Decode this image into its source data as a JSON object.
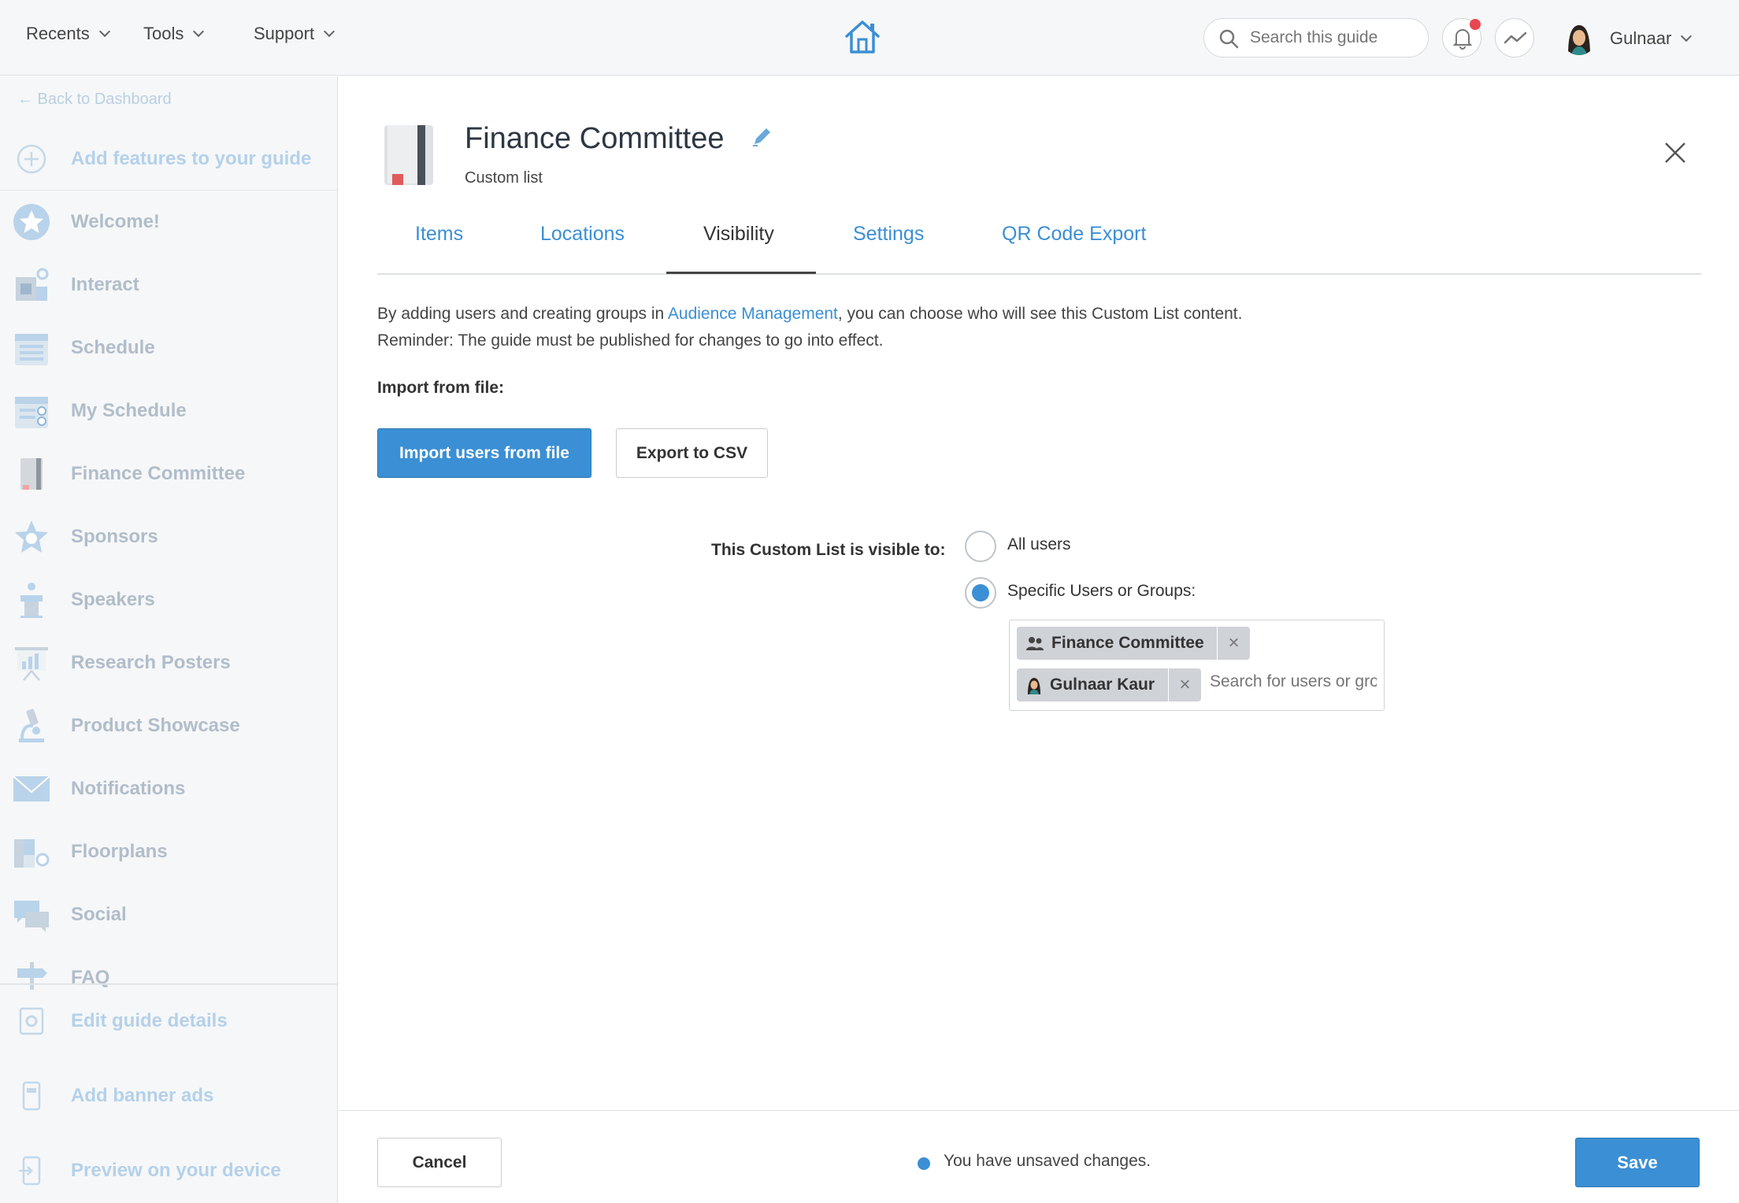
{
  "topbar": {
    "recents_label": "Recents",
    "tools_label": "Tools",
    "support_label": "Support",
    "search_placeholder": "Search this guide",
    "user_name": "Gulnaar"
  },
  "sidebar": {
    "back_label": "← Back to Dashboard",
    "add_features_label": "Add features to your guide",
    "items": [
      {
        "label": "Welcome!",
        "icon": "star-icon"
      },
      {
        "label": "Interact",
        "icon": "interact-icon"
      },
      {
        "label": "Schedule",
        "icon": "calendar-icon"
      },
      {
        "label": "My Schedule",
        "icon": "calendar-check-icon"
      },
      {
        "label": "Finance Committee",
        "icon": "book-icon"
      },
      {
        "label": "Sponsors",
        "icon": "sponsor-star-icon"
      },
      {
        "label": "Speakers",
        "icon": "podium-icon"
      },
      {
        "label": "Research Posters",
        "icon": "poster-icon"
      },
      {
        "label": "Product Showcase",
        "icon": "microscope-icon"
      },
      {
        "label": "Notifications",
        "icon": "envelope-icon"
      },
      {
        "label": "Floorplans",
        "icon": "floorplan-icon"
      },
      {
        "label": "Social",
        "icon": "chat-icon"
      },
      {
        "label": "FAQ",
        "icon": "signpost-icon"
      }
    ],
    "bottom": {
      "edit_label": "Edit guide details",
      "banner_label": "Add banner ads",
      "preview_label": "Preview on your device"
    }
  },
  "header": {
    "title": "Finance Committee",
    "subtitle": "Custom list"
  },
  "tabs": {
    "items": "Items",
    "locations": "Locations",
    "visibility": "Visibility",
    "settings": "Settings",
    "qr": "QR Code Export"
  },
  "content": {
    "info_prefix": "By adding users and creating groups in ",
    "info_link": "Audience Management",
    "info_suffix": ", you can choose who will see this Custom List content.",
    "reminder": "Reminder: The guide must be published for changes to go into effect.",
    "import_label": "Import from file:",
    "import_button": "Import users from file",
    "export_button": "Export to CSV",
    "visible_label": "This Custom List is visible to:",
    "radio_all": "All users",
    "radio_specific": "Specific Users or Groups:",
    "selected_option": "Specific Users or Groups:",
    "tags": [
      "Finance Committee",
      "Gulnaar Kaur"
    ],
    "tag_search_placeholder": "Search for users or groups"
  },
  "footer": {
    "cancel": "Cancel",
    "unsaved": "You have unsaved changes.",
    "save": "Save"
  },
  "colors": {
    "accent": "#3b8fd4",
    "notification": "#e8474f"
  }
}
